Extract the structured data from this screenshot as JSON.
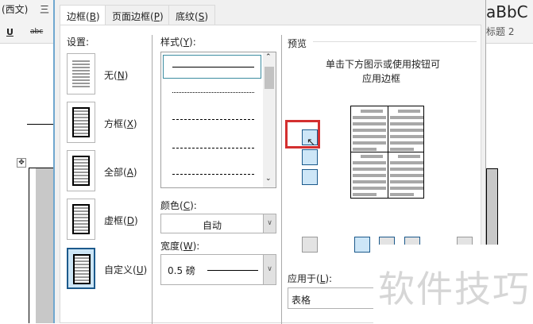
{
  "background": {
    "font_box": "(西文)",
    "font_box2": "三",
    "underline": "U",
    "strike": "abc",
    "style_preview": "aBbC",
    "style_name": "标题 2",
    "para_mark": "↵",
    "move_handle": "✥"
  },
  "tabs": [
    {
      "label": "边框(",
      "key": "B",
      "end": ")"
    },
    {
      "label": "页面边框(",
      "key": "P",
      "end": ")"
    },
    {
      "label": "底纹(",
      "key": "S",
      "end": ")"
    }
  ],
  "settings": {
    "title": "设置:",
    "items": [
      {
        "label": "无(",
        "key": "N",
        "end": ")"
      },
      {
        "label": "方框(",
        "key": "X",
        "end": ")"
      },
      {
        "label": "全部(",
        "key": "A",
        "end": ")"
      },
      {
        "label": "虚框(",
        "key": "D",
        "end": ")"
      },
      {
        "label": "自定义(",
        "key": "U",
        "end": ")"
      }
    ],
    "selected": "自定义"
  },
  "style": {
    "title": "样式(",
    "key": "Y",
    "end": "):"
  },
  "color": {
    "title": "颜色(",
    "key": "C",
    "end": "):",
    "value": "自动"
  },
  "width": {
    "title": "宽度(",
    "key": "W",
    "end": "):",
    "value": "0.5 磅"
  },
  "preview": {
    "title": "预览",
    "hint1": "单击下方图示或使用按钮可",
    "hint2": "应用边框"
  },
  "apply_to": {
    "title": "应用于(",
    "key": "L",
    "end": "):",
    "value": "表格"
  },
  "watermark": "软件技巧",
  "colors": {
    "highlight": "#d32f2f",
    "accent": "#1c5a8c"
  }
}
